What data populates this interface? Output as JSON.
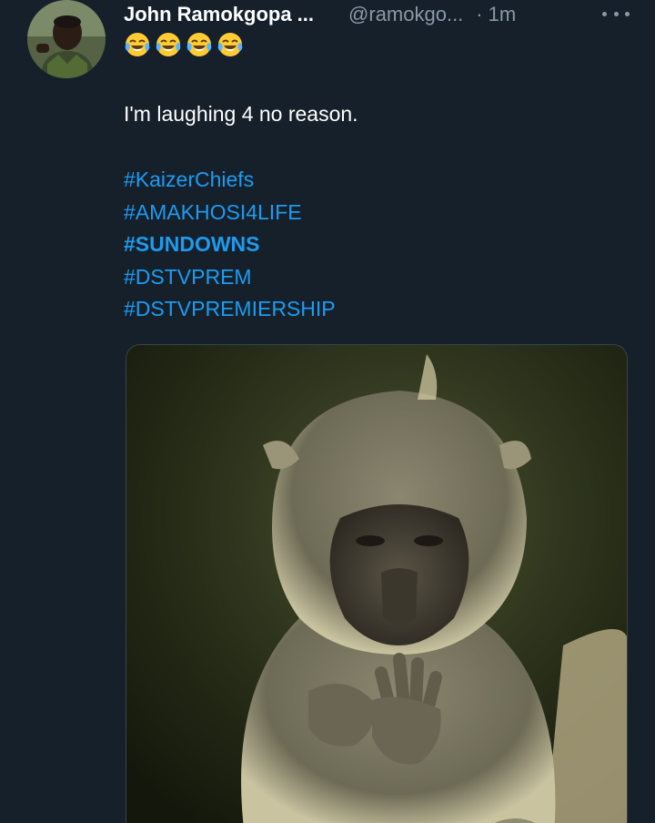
{
  "tweet": {
    "author": {
      "display_name": "John Ramokgopa ...",
      "handle": "@ramokgo...",
      "separator": "·",
      "time": "1m",
      "avatar_icon": "user-avatar"
    },
    "emojis": [
      "😂",
      "😂",
      "😂",
      "😂"
    ],
    "text": "I'm laughing 4 no reason.",
    "hashtags": [
      {
        "text": "#KaizerChiefs",
        "bold": false
      },
      {
        "text": "#AMAKHOSI4LIFE",
        "bold": false
      },
      {
        "text": "#SUNDOWNS",
        "bold": true
      },
      {
        "text": "#DSTVPREM",
        "bold": false
      },
      {
        "text": "#DSTVPREMIERSHIP",
        "bold": false
      }
    ],
    "more_icon": "more-horizontal-icon",
    "media": {
      "kind": "photo",
      "icon": "baboon-photo"
    }
  },
  "colors": {
    "background": "#15202b",
    "text_primary": "#ffffff",
    "text_secondary": "#8b98a5",
    "link": "#1d9bf0",
    "border": "#38444d"
  }
}
